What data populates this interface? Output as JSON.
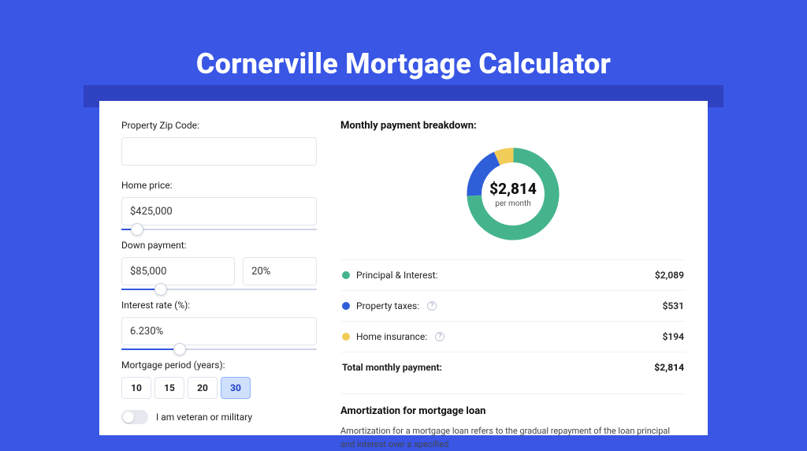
{
  "page": {
    "title": "Cornerville Mortgage Calculator"
  },
  "form": {
    "zip": {
      "label": "Property Zip Code:",
      "value": ""
    },
    "price": {
      "label": "Home price:",
      "value": "$425,000",
      "slider_pct": 8
    },
    "down": {
      "label": "Down payment:",
      "value": "$85,000",
      "pct": "20%",
      "slider_pct": 20
    },
    "rate": {
      "label": "Interest rate (%):",
      "value": "6.230%",
      "slider_pct": 30
    },
    "period": {
      "label": "Mortgage period (years):",
      "options": [
        "10",
        "15",
        "20",
        "30"
      ],
      "selected": "30"
    },
    "veteran": {
      "label": "I am veteran or military",
      "on": false
    }
  },
  "breakdown": {
    "title": "Monthly payment breakdown:",
    "center_amount": "$2,814",
    "center_sub": "per month",
    "items": [
      {
        "key": "pi",
        "label": "Principal & Interest:",
        "value": "$2,089",
        "color": "#45b48c",
        "info": false
      },
      {
        "key": "tax",
        "label": "Property taxes:",
        "value": "$531",
        "color": "#2f5ed9",
        "info": true
      },
      {
        "key": "ins",
        "label": "Home insurance:",
        "value": "$194",
        "color": "#f2cc58",
        "info": true
      }
    ],
    "total": {
      "label": "Total monthly payment:",
      "value": "$2,814"
    }
  },
  "amort": {
    "title": "Amortization for mortgage loan",
    "body": "Amortization for a mortgage loan refers to the gradual repayment of the loan principal and interest over a specified"
  },
  "chart_data": {
    "type": "pie",
    "title": "Monthly payment breakdown",
    "total_label": "$2,814 per month",
    "series": [
      {
        "name": "Principal & Interest",
        "value": 2089,
        "color": "#45b48c"
      },
      {
        "name": "Property taxes",
        "value": 531,
        "color": "#2f5ed9"
      },
      {
        "name": "Home insurance",
        "value": 194,
        "color": "#f2cc58"
      }
    ]
  }
}
